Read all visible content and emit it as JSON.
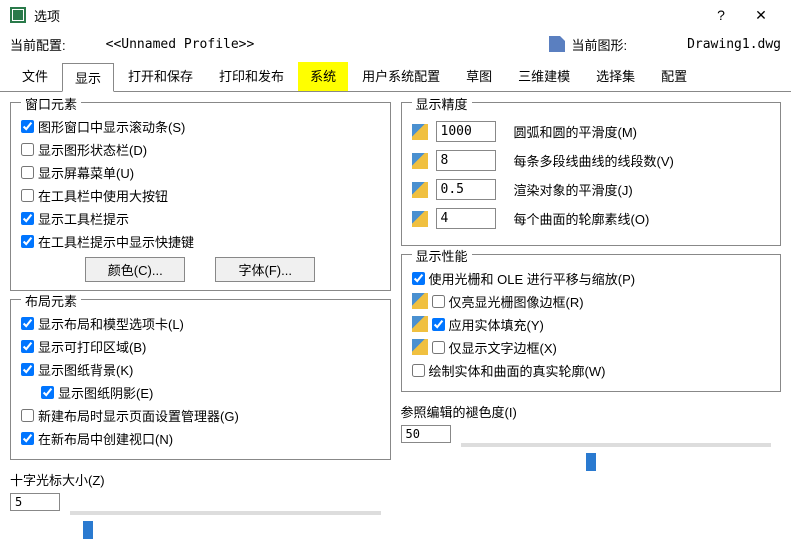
{
  "title": "选项",
  "profile": {
    "current_label": "当前配置:",
    "current_value": "<<Unnamed Profile>>",
    "drawing_label": "当前图形:",
    "drawing_value": "Drawing1.dwg"
  },
  "tabs": [
    "文件",
    "显示",
    "打开和保存",
    "打印和发布",
    "系统",
    "用户系统配置",
    "草图",
    "三维建模",
    "选择集",
    "配置"
  ],
  "active_tab": 1,
  "highlight_tab": 4,
  "groups": {
    "window": {
      "title": "窗口元素",
      "items": [
        {
          "label": "图形窗口中显示滚动条(S)",
          "checked": true
        },
        {
          "label": "显示图形状态栏(D)",
          "checked": false
        },
        {
          "label": "显示屏幕菜单(U)",
          "checked": false
        },
        {
          "label": "在工具栏中使用大按钮",
          "checked": false
        },
        {
          "label": "显示工具栏提示",
          "checked": true
        },
        {
          "label": "在工具栏提示中显示快捷键",
          "checked": true
        }
      ],
      "buttons": {
        "color": "颜色(C)...",
        "font": "字体(F)..."
      }
    },
    "layout": {
      "title": "布局元素",
      "items": [
        {
          "label": "显示布局和模型选项卡(L)",
          "checked": true
        },
        {
          "label": "显示可打印区域(B)",
          "checked": true
        },
        {
          "label": "显示图纸背景(K)",
          "checked": true
        },
        {
          "label": "显示图纸阴影(E)",
          "checked": true,
          "indent": true
        },
        {
          "label": "新建布局时显示页面设置管理器(G)",
          "checked": false
        },
        {
          "label": "在新布局中创建视口(N)",
          "checked": true
        }
      ]
    },
    "precision": {
      "title": "显示精度",
      "rows": [
        {
          "value": "1000",
          "label": "圆弧和圆的平滑度(M)"
        },
        {
          "value": "8",
          "label": "每条多段线曲线的线段数(V)"
        },
        {
          "value": "0.5",
          "label": "渲染对象的平滑度(J)"
        },
        {
          "value": "4",
          "label": "每个曲面的轮廓素线(O)"
        }
      ]
    },
    "performance": {
      "title": "显示性能",
      "items": [
        {
          "label": "使用光栅和 OLE 进行平移与缩放(P)",
          "checked": true,
          "icon": false
        },
        {
          "label": "仅亮显光栅图像边框(R)",
          "checked": false,
          "icon": true
        },
        {
          "label": "应用实体填充(Y)",
          "checked": true,
          "icon": true
        },
        {
          "label": "仅显示文字边框(X)",
          "checked": false,
          "icon": true
        },
        {
          "label": "绘制实体和曲面的真实轮廓(W)",
          "checked": false,
          "icon": false
        }
      ]
    },
    "cross": {
      "title": "十字光标大小(Z)",
      "value": "5",
      "pct": 5
    },
    "fade": {
      "title": "参照编辑的褪色度(I)",
      "value": "50",
      "pct": 50
    }
  }
}
